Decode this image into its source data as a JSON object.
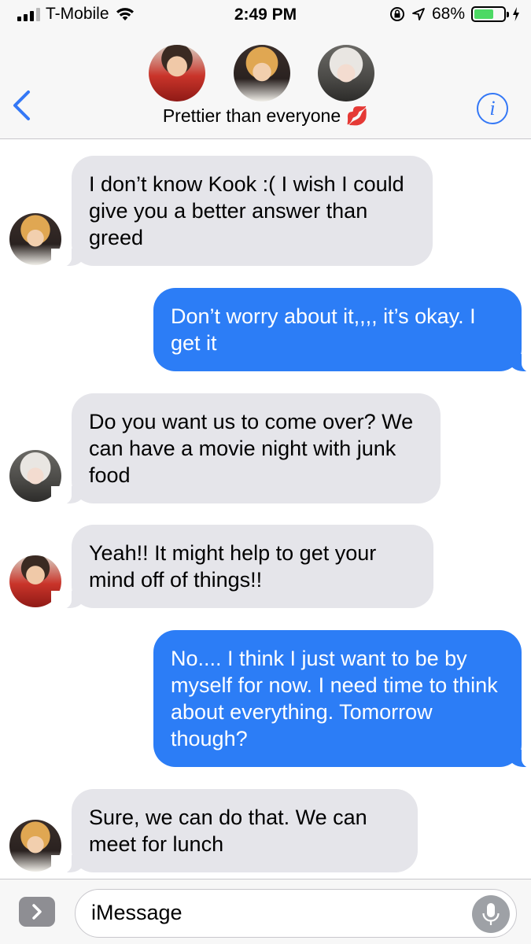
{
  "status_bar": {
    "carrier": "T-Mobile",
    "time": "2:49 PM",
    "battery_percent_label": "68%",
    "battery_level": 0.68
  },
  "header": {
    "group_name": "Prettier than everyone 💋",
    "info_label": "i"
  },
  "messages": [
    {
      "direction": "incoming",
      "sender_avatar": "blond-avatar",
      "text": "I don’t know Kook :( I wish I could give you a better answer than greed"
    },
    {
      "direction": "outgoing",
      "text": "Don’t worry about it,,,, it’s okay. I get it"
    },
    {
      "direction": "incoming",
      "sender_avatar": "white-hair-avatar",
      "text": "Do you want us to come over? We can have a movie night with junk food"
    },
    {
      "direction": "incoming",
      "sender_avatar": "red-avatar",
      "text": "Yeah!! It might help to get your mind off of things!!"
    },
    {
      "direction": "outgoing",
      "text": "No.... I think I just want to be by myself for now. I need time to think about everything. Tomorrow though?"
    },
    {
      "direction": "incoming",
      "sender_avatar": "blond-avatar",
      "text": "Sure, we can do that. We can meet for lunch"
    }
  ],
  "input": {
    "placeholder": "iMessage"
  },
  "colors": {
    "accent": "#3478f6",
    "outgoing_bubble": "#2c7df6",
    "incoming_bubble": "#e5e5ea",
    "battery": "#4cd964"
  }
}
